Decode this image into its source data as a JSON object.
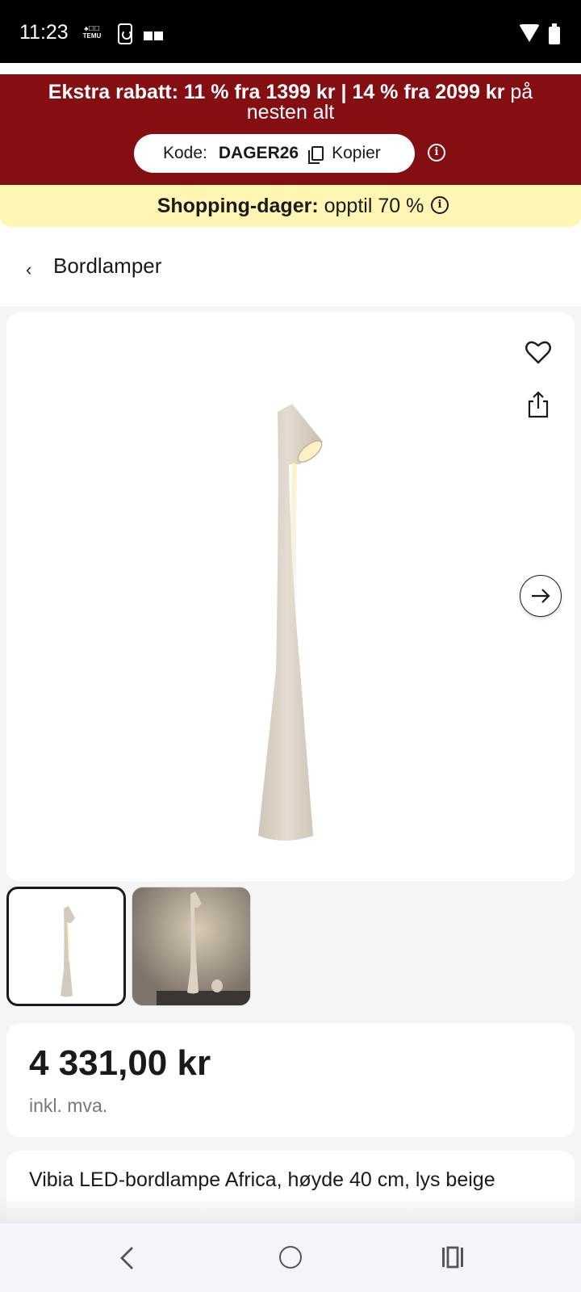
{
  "status_bar": {
    "time": "11:23",
    "temu_label": "TEMU"
  },
  "promo": {
    "headline_bold": "Ekstra rabatt: 11 % fra 1399 kr | 14 % fra 2099 kr",
    "headline_rest": " på nesten alt",
    "code_label": "Kode:",
    "code_value": "DAGER26",
    "copy_label": "Kopier",
    "shopping_bold": "Shopping-dager:",
    "shopping_rest": " opptil 70 %"
  },
  "breadcrumb": {
    "label": "Bordlamper"
  },
  "product": {
    "price": "4 331,00 kr",
    "vat_note": "inkl. mva.",
    "title": "Vibia LED-bordlampe Africa, høyde 40 cm, lys beige",
    "thumbnails": [
      "lamp-product-image",
      "lamp-room-image"
    ],
    "selected_thumbnail": 0
  },
  "colors": {
    "promo_red": "#840e11",
    "promo_yellow": "#fff6b3",
    "lamp_beige": "#d8cfc2"
  },
  "icons": {
    "favorite": "heart-icon",
    "share": "share-icon",
    "next": "arrow-right-icon",
    "back": "chevron-left-icon",
    "copy": "copy-icon",
    "info": "info-icon"
  }
}
